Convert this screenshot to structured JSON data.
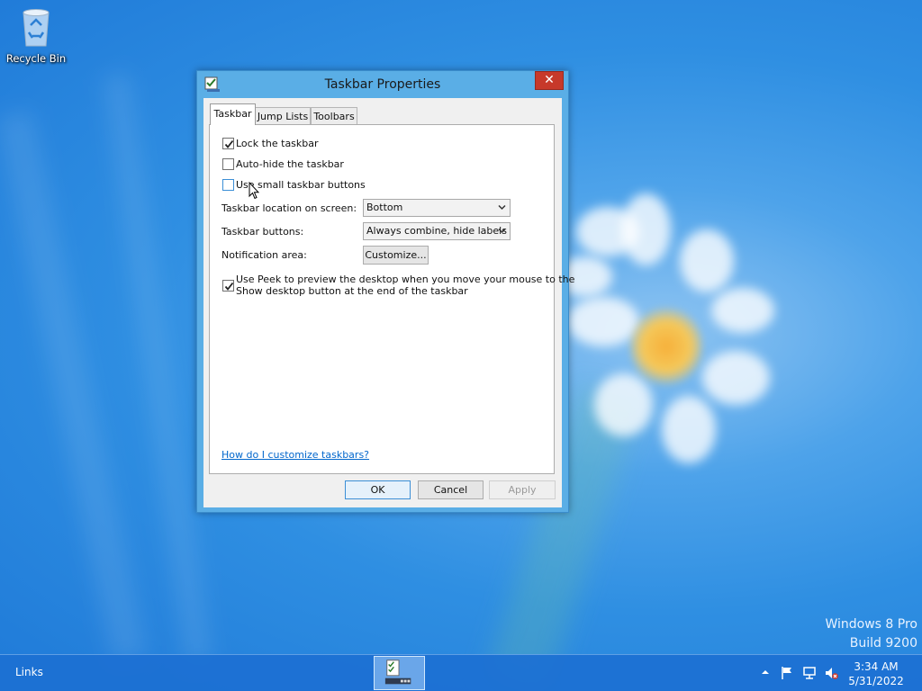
{
  "desktop": {
    "recycle_bin_label": "Recycle Bin",
    "watermark_line1": "Windows 8 Pro",
    "watermark_line2": "Build 9200",
    "accent_color": "#2f8fe2"
  },
  "dialog": {
    "title": "Taskbar Properties",
    "close_label": "✕",
    "tabs": [
      {
        "label": "Taskbar",
        "active": true
      },
      {
        "label": "Jump Lists",
        "active": false
      },
      {
        "label": "Toolbars",
        "active": false
      }
    ],
    "options": {
      "lock_taskbar": {
        "label": "Lock the taskbar",
        "checked": true
      },
      "auto_hide": {
        "label": "Auto-hide the taskbar",
        "checked": false
      },
      "small_buttons": {
        "label": "Use small taskbar buttons",
        "checked": false
      },
      "peek": {
        "label_line1": "Use Peek to preview the desktop when you move your mouse to the",
        "label_line2": "Show desktop button at the end of the taskbar",
        "checked": true
      }
    },
    "location": {
      "label": "Taskbar location on screen:",
      "value": "Bottom"
    },
    "buttons_setting": {
      "label": "Taskbar buttons:",
      "value": "Always combine, hide labels"
    },
    "notification": {
      "label": "Notification area:",
      "button_label": "Customize..."
    },
    "help_link": "How do I customize taskbars?",
    "ok_label": "OK",
    "cancel_label": "Cancel",
    "apply_label": "Apply"
  },
  "taskbar": {
    "links_label": "Links",
    "clock_time": "3:34 AM",
    "clock_date": "5/31/2022",
    "tray_icons": [
      "show-hidden-icons-arrow",
      "flag-icon",
      "network-icon",
      "speaker-muted-icon"
    ]
  }
}
